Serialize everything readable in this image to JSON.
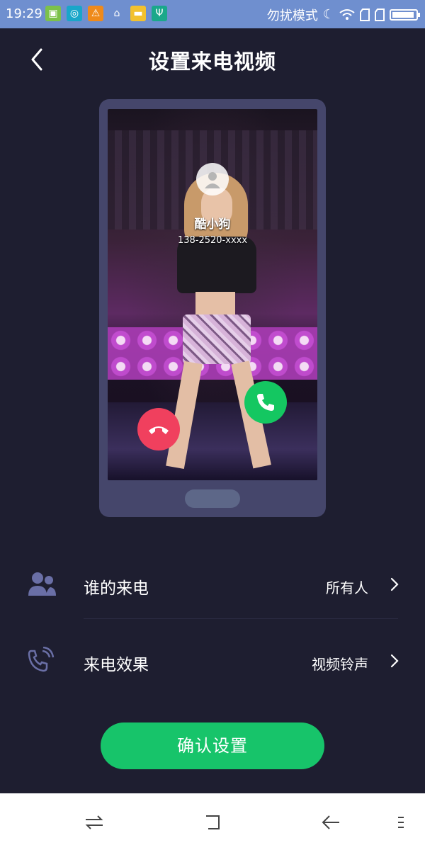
{
  "status_bar": {
    "time": "19:29",
    "mode_text": "勿扰模式",
    "battery_level": 0.95,
    "left_icons": [
      "app-store-icon",
      "browser-icon",
      "warning-icon",
      "clean-icon",
      "folder-icon",
      "usb-icon"
    ]
  },
  "header": {
    "title": "设置来电视频",
    "back_icon": "back-arrow-icon"
  },
  "preview": {
    "caller_name": "酷小狗",
    "caller_number": "138-2520-xxxx",
    "colors": {
      "hangup": "#f0405e",
      "answer": "#14c761",
      "frame": "#45466b"
    }
  },
  "settings": [
    {
      "label": "谁的来电",
      "value": "所有人",
      "icon": "contacts-icon"
    },
    {
      "label": "来电效果",
      "value": "视频铃声",
      "icon": "ringing-phone-icon"
    }
  ],
  "confirm_label": "确认设置",
  "nav": [
    "switch-apps-icon",
    "home-square-icon",
    "back-icon",
    "menu-icon"
  ],
  "colors": {
    "background": "#1e1e30",
    "accent": "#17c46a",
    "status_bar": "#6f8fcf"
  }
}
